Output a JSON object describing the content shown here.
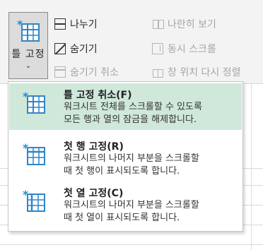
{
  "ribbon": {
    "freeze_button": {
      "label": "틀 고정"
    },
    "split": {
      "label": "나누기"
    },
    "hide": {
      "label": "숨기기"
    },
    "unhide": {
      "label": "숨기기 취소"
    },
    "view_side_by_side": {
      "label": "나란히 보기"
    },
    "sync_scroll": {
      "label": "동시 스크롤"
    },
    "reset_window_position": {
      "label": "창 위치 다시 정렬"
    }
  },
  "menu": {
    "items": [
      {
        "title": "틀 고정 취소(F)",
        "desc1": "워크시트 전체를 스크롤할 수 있도록",
        "desc2": "모든 행과 열의 잠금을 해제합니다."
      },
      {
        "title": "첫 행 고정(R)",
        "desc1": "워크시트의 나머지 부분을 스크롤할",
        "desc2": "때 첫 행이 표시되도록 합니다."
      },
      {
        "title": "첫 열 고정(C)",
        "desc1": "워크시트의 나머지 부분을 스크롤할",
        "desc2": "때 첫 열이 표시되도록 합니다."
      }
    ]
  },
  "colors": {
    "highlight": "#cfe8da",
    "icon_blue": "#2f86c8",
    "snowflake": "#1e8fd6"
  }
}
